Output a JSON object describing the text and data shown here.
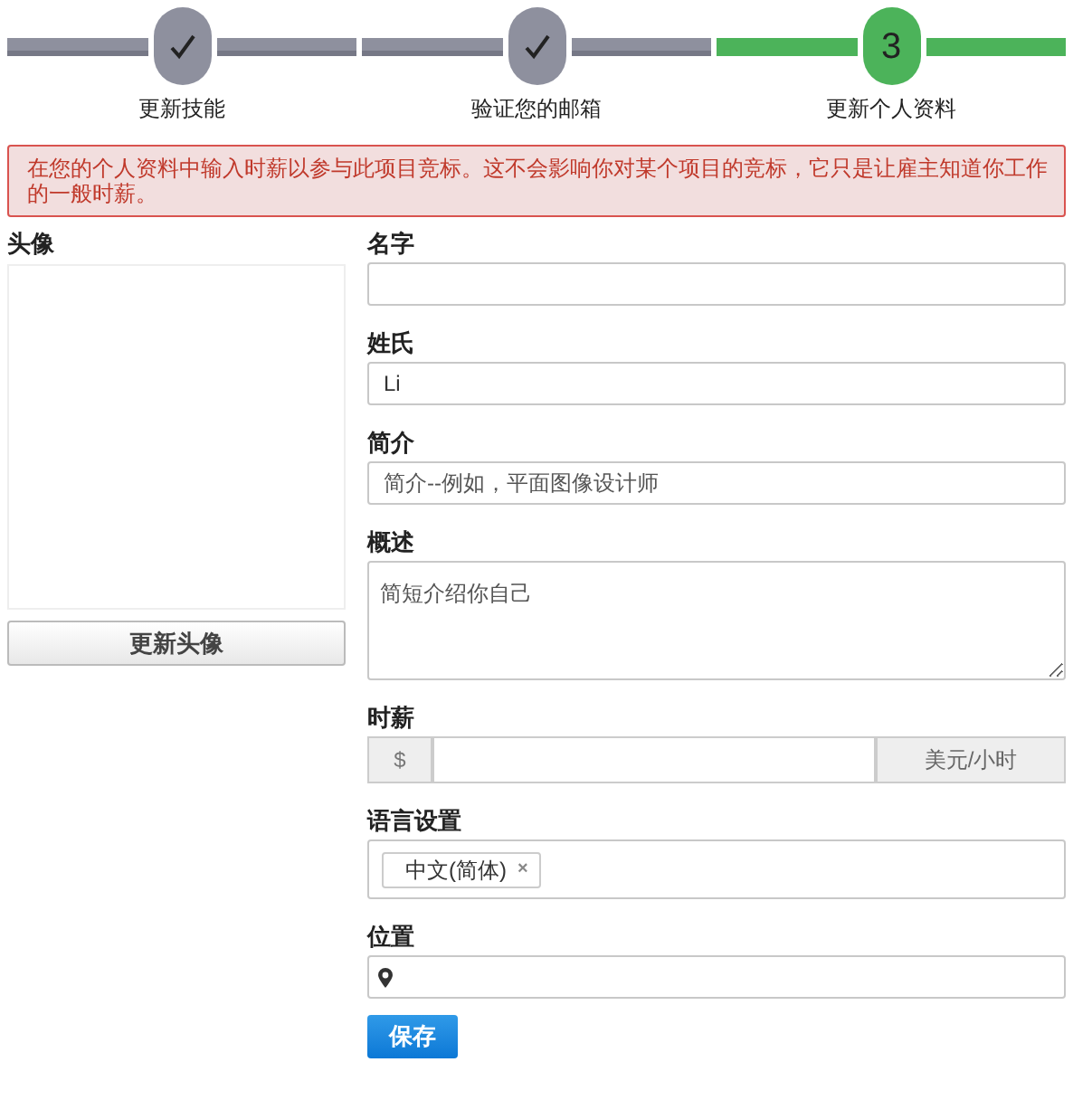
{
  "steps": [
    {
      "label": "更新技能",
      "completed": true
    },
    {
      "label": "验证您的邮箱",
      "completed": true
    },
    {
      "label": "更新个人资料",
      "completed": false,
      "number": "3"
    }
  ],
  "alert": "在您的个人资料中输入时薪以参与此项目竞标。这不会影响你对某个项目的竞标，它只是让雇主知道你工作的一般时薪。",
  "avatar": {
    "label": "头像",
    "button": "更新头像"
  },
  "fields": [
    {
      "kind": "text",
      "label": "名字"
    },
    {
      "kind": "text",
      "label": "姓氏",
      "value": "Li"
    },
    {
      "kind": "text",
      "label": "简介",
      "placeholder": "简介--例如，平面图像设计师"
    },
    {
      "kind": "textarea",
      "label": "概述",
      "placeholder": "简短介绍你自己"
    },
    {
      "kind": "rate",
      "label": "时薪",
      "prefix": "$",
      "suffix": "美元/小时"
    },
    {
      "kind": "tags",
      "label": "语言设置",
      "tags": [
        {
          "text": "中文(简体)",
          "remove": "×"
        }
      ]
    },
    {
      "kind": "location",
      "label": "位置"
    }
  ],
  "save_button": "保存"
}
